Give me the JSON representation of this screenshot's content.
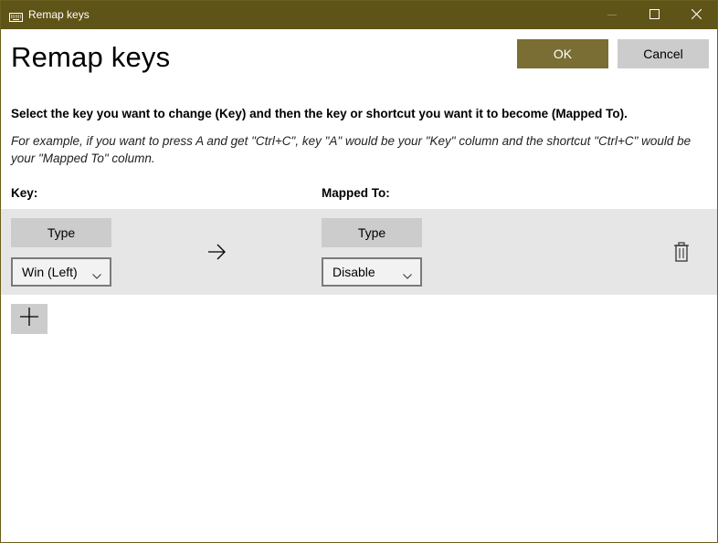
{
  "window": {
    "title": "Remap keys",
    "heading": "Remap keys"
  },
  "icons": {
    "app": "keyboard-icon",
    "minimize": "minimize-icon",
    "maximize": "maximize-icon",
    "close": "close-icon",
    "arrow": "arrow-right-icon",
    "delete": "trash-icon",
    "add": "plus-icon",
    "dropdown": "chevron-down-icon"
  },
  "buttons": {
    "ok": "OK",
    "cancel": "Cancel"
  },
  "instruction": "Select the key you want to change (Key) and then the key or shortcut you want it to become (Mapped To).",
  "example": "For example, if you want to press A and get \"Ctrl+C\", key \"A\" would be your \"Key\" column and the shortcut \"Ctrl+C\" would be your \"Mapped To\" column.",
  "columns": {
    "key": "Key:",
    "mapped_to": "Mapped To:"
  },
  "mappings": [
    {
      "key_type_label": "Type",
      "key_value": "Win (Left)",
      "mapped_type_label": "Type",
      "mapped_value": "Disable"
    }
  ],
  "colors": {
    "titlebar": "#5f5418",
    "accent": "#7a6e34",
    "row_background": "#e6e6e6",
    "button_gray": "#cccccc"
  }
}
